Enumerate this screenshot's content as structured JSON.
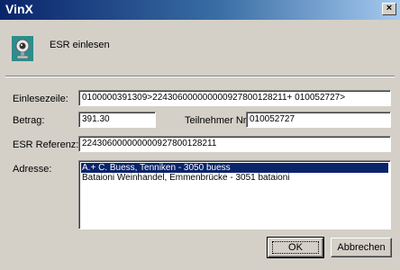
{
  "window": {
    "title": "VinX",
    "close_label": "×"
  },
  "header": {
    "icon": "webcam-icon",
    "label": "ESR einlesen"
  },
  "form": {
    "einlesezeile_label": "Einlesezeile:",
    "einlesezeile_value": "0100000391309>224306000000000927800128211+ 010052727>",
    "betrag_label": "Betrag:",
    "betrag_value": "391.30",
    "teilnehmer_label": "Teilnehmer Nr.:",
    "teilnehmer_value": "010052727",
    "esr_label": "ESR Referenz:",
    "esr_value": "224306000000000927800128211",
    "adresse_label": "Adresse:"
  },
  "addresses": [
    {
      "text": "A.+ C. Buess, Tenniken - 3050 buess",
      "selected": true
    },
    {
      "text": "Bataioni Weinhandel, Emmenbrücke - 3051 bataioni",
      "selected": false
    }
  ],
  "buttons": {
    "ok_label": "OK",
    "cancel_label": "Abbrechen"
  },
  "colors": {
    "title_bar": "#0a246a",
    "selection": "#0a246a",
    "face": "#d4d0c8"
  }
}
